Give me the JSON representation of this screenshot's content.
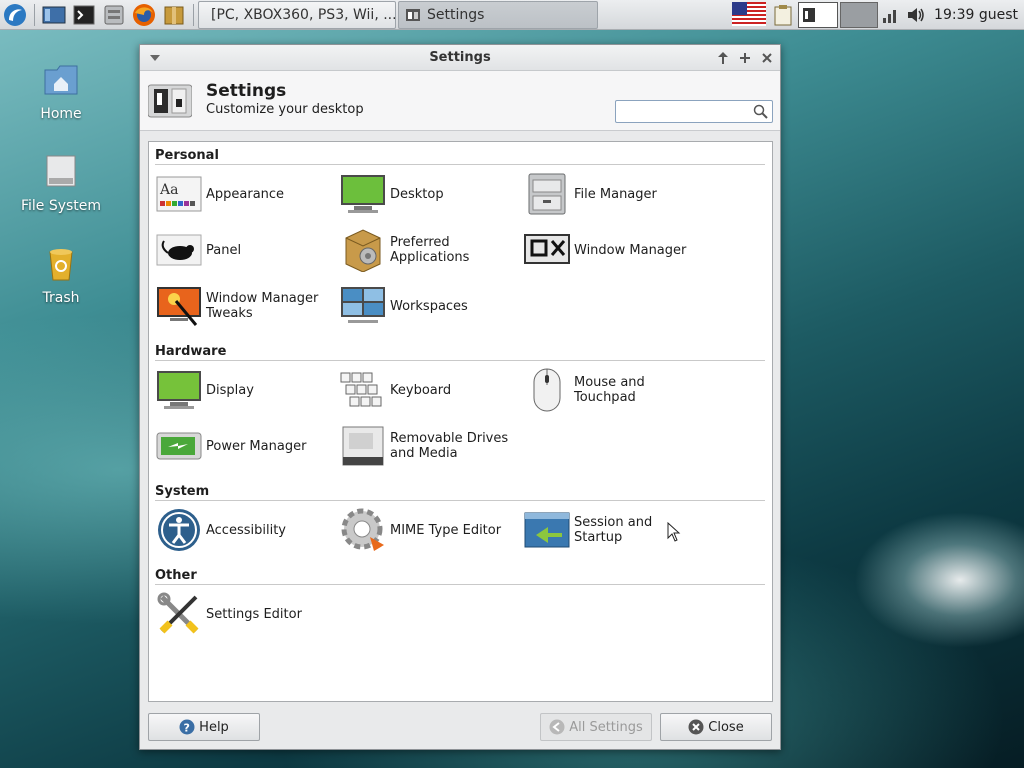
{
  "panel": {
    "tasks": [
      {
        "label": "[PC, XBOX360, PS3, Wii, ...",
        "icon": "firefox-icon"
      },
      {
        "label": "Settings",
        "icon": "settings-icon"
      }
    ],
    "clock": "19:39",
    "user": "guest"
  },
  "desktop": {
    "icons": [
      {
        "label": "Home"
      },
      {
        "label": "File System"
      },
      {
        "label": "Trash"
      }
    ]
  },
  "window": {
    "title": "Settings",
    "header_title": "Settings",
    "header_subtitle": "Customize your desktop",
    "search_placeholder": "",
    "categories": [
      {
        "name": "Personal",
        "items": [
          "Appearance",
          "Desktop",
          "File Manager",
          "Panel",
          "Preferred Applications",
          "Window Manager",
          "Window Manager Tweaks",
          "Workspaces"
        ]
      },
      {
        "name": "Hardware",
        "items": [
          "Display",
          "Keyboard",
          "Mouse and Touchpad",
          "Power Manager",
          "Removable Drives and Media"
        ]
      },
      {
        "name": "System",
        "items": [
          "Accessibility",
          "MIME Type Editor",
          "Session and Startup"
        ]
      },
      {
        "name": "Other",
        "items": [
          "Settings Editor"
        ]
      }
    ],
    "buttons": {
      "help": "Help",
      "all_settings": "All Settings",
      "close": "Close"
    }
  }
}
